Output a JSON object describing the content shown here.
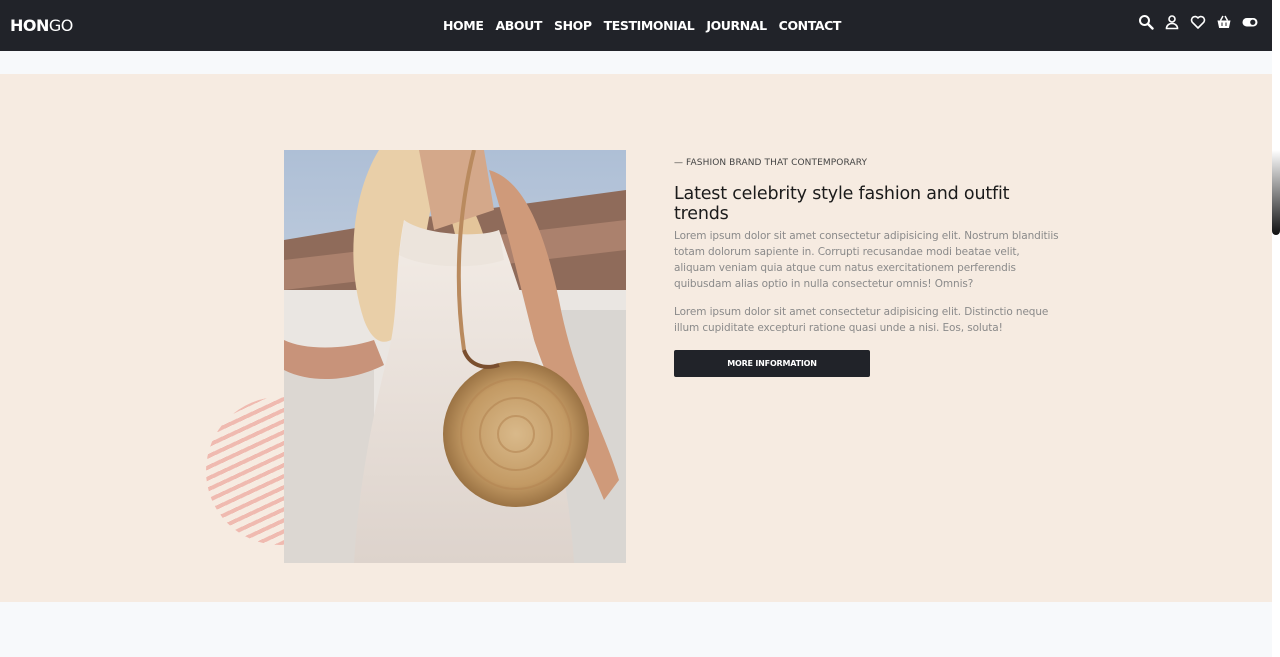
{
  "navbar": {
    "logo_bold": "HON",
    "logo_thin": "GO",
    "links": [
      "HOME",
      "ABOUT",
      "SHOP",
      "TESTIMONIAL",
      "JOURNAL",
      "CONTACT"
    ],
    "icons": [
      "search-icon",
      "user-icon",
      "heart-icon",
      "basket-icon",
      "toggle-icon"
    ]
  },
  "hero": {
    "tagline": "— FASHION BRAND THAT CONTEMPORARY",
    "headline": "Latest celebrity style fashion and outfit trends",
    "paragraph1": "Lorem ipsum dolor sit amet consectetur adipisicing elit. Nostrum blanditiis totam dolorum sapiente in. Corrupti recusandae modi beatae velit, aliquam veniam quia atque cum natus exercitationem perferendis quibusdam alias optio in nulla consectetur omnis! Omnis?",
    "paragraph2": "Lorem ipsum dolor sit amet consectetur adipisicing elit. Distinctio neque illum cupiditate excepturi ratione quasi unde a nisi. Eos, soluta!",
    "button_label": "MORE INFORMATION"
  },
  "colors": {
    "navbar_bg": "#212329",
    "hero_bg": "#f6ebe1",
    "accent_stripes": "#efb7ad"
  }
}
